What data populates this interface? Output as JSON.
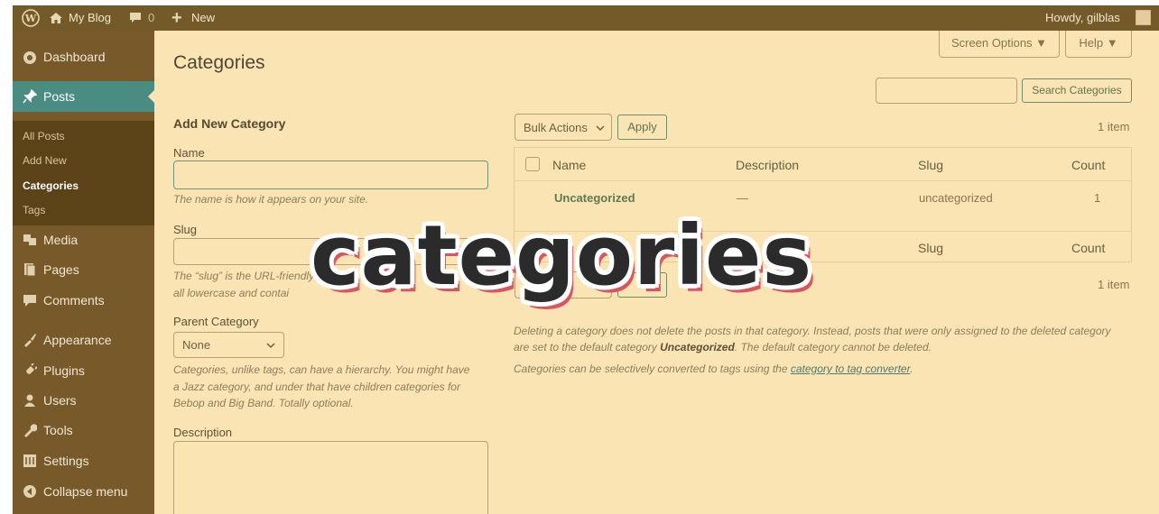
{
  "adminbar": {
    "site_name": "My Blog",
    "comments_count": "0",
    "new_label": "New",
    "howdy": "Howdy, gilblas"
  },
  "sidebar": {
    "items": [
      {
        "label": "Dashboard",
        "icon": "dashboard-icon"
      },
      {
        "label": "Posts",
        "icon": "pin-icon"
      },
      {
        "label": "Media",
        "icon": "media-icon"
      },
      {
        "label": "Pages",
        "icon": "pages-icon"
      },
      {
        "label": "Comments",
        "icon": "comments-icon"
      },
      {
        "label": "Appearance",
        "icon": "brush-icon"
      },
      {
        "label": "Plugins",
        "icon": "plug-icon"
      },
      {
        "label": "Users",
        "icon": "users-icon"
      },
      {
        "label": "Tools",
        "icon": "wrench-icon"
      },
      {
        "label": "Settings",
        "icon": "settings-icon"
      },
      {
        "label": "Collapse menu",
        "icon": "collapse-icon"
      }
    ],
    "submenu": [
      "All Posts",
      "Add New",
      "Categories",
      "Tags"
    ]
  },
  "screen_options": "Screen Options ▼",
  "help": "Help ▼",
  "page_title": "Categories",
  "search_button": "Search Categories",
  "search_value": "",
  "add_new": {
    "heading": "Add New Category",
    "name_label": "Name",
    "name_value": "",
    "name_hint": "The name is how it appears on your site.",
    "slug_label": "Slug",
    "slug_value": "",
    "slug_hint_1": "The “slug” is the URL-friendly versio",
    "slug_hint_2": "all lowercase and contai",
    "parent_label": "Parent Category",
    "parent_value": "None",
    "parent_hint_1": "Categories, unlike tags, can have a hierarchy. You might have",
    "parent_hint_2": "a Jazz category, and under that have children categories for",
    "parent_hint_3": "Bebop and Big Band. Totally optional.",
    "description_label": "Description",
    "description_value": ""
  },
  "bulk": {
    "actions": "Bulk Actions",
    "apply": "Apply",
    "item_count": "1 item"
  },
  "table": {
    "headers": [
      "Name",
      "Description",
      "Slug",
      "Count"
    ],
    "rows": [
      {
        "name": "Uncategorized",
        "description": "—",
        "slug": "uncategorized",
        "count": "1"
      }
    ]
  },
  "notes": {
    "line1": "Deleting a category does not delete the posts in that category. Instead, posts that were only assigned to the deleted category",
    "line2_prefix": "are set to the default category ",
    "line2_bold": "Uncategorized",
    "line2_suffix": ". The default category cannot be deleted.",
    "line3_prefix": "Categories can be selectively converted to tags using the ",
    "line3_link": "category to tag converter",
    "line3_suffix": "."
  },
  "overlay_word": "categories"
}
